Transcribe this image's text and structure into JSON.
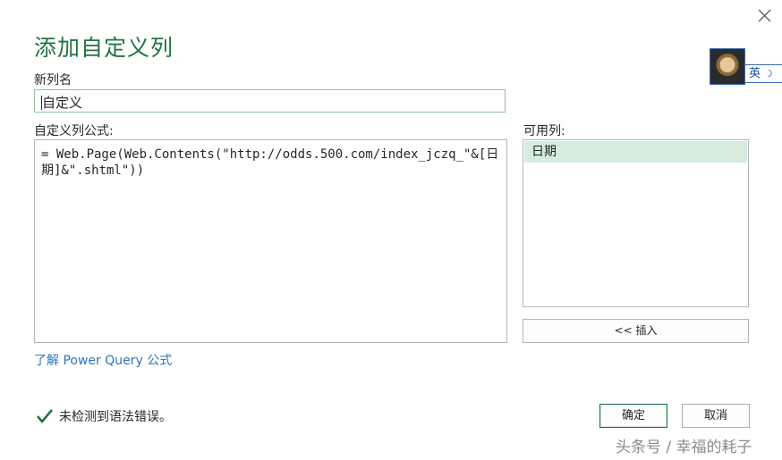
{
  "dialog": {
    "title": "添加自定义列",
    "column_name_label": "新列名",
    "column_name_value": "自定义",
    "formula_label": "自定义列公式:",
    "formula_value": "= Web.Page(Web.Contents(\"http://odds.500.com/index_jczq_\"&[日期]&\".shtml\"))",
    "available_label": "可用列:",
    "available_columns": [
      "日期"
    ],
    "insert_label": "<< 插入",
    "learn_link": "了解 Power Query 公式",
    "status_text": "未检测到语法错误。",
    "ok_label": "确定",
    "cancel_label": "取消"
  },
  "ime": {
    "mode_label": "英"
  },
  "watermark": "头条号 / 幸福的耗子",
  "colors": {
    "accent": "#217346",
    "selected_item": "#d5ecdc",
    "link": "#2e75b6"
  }
}
